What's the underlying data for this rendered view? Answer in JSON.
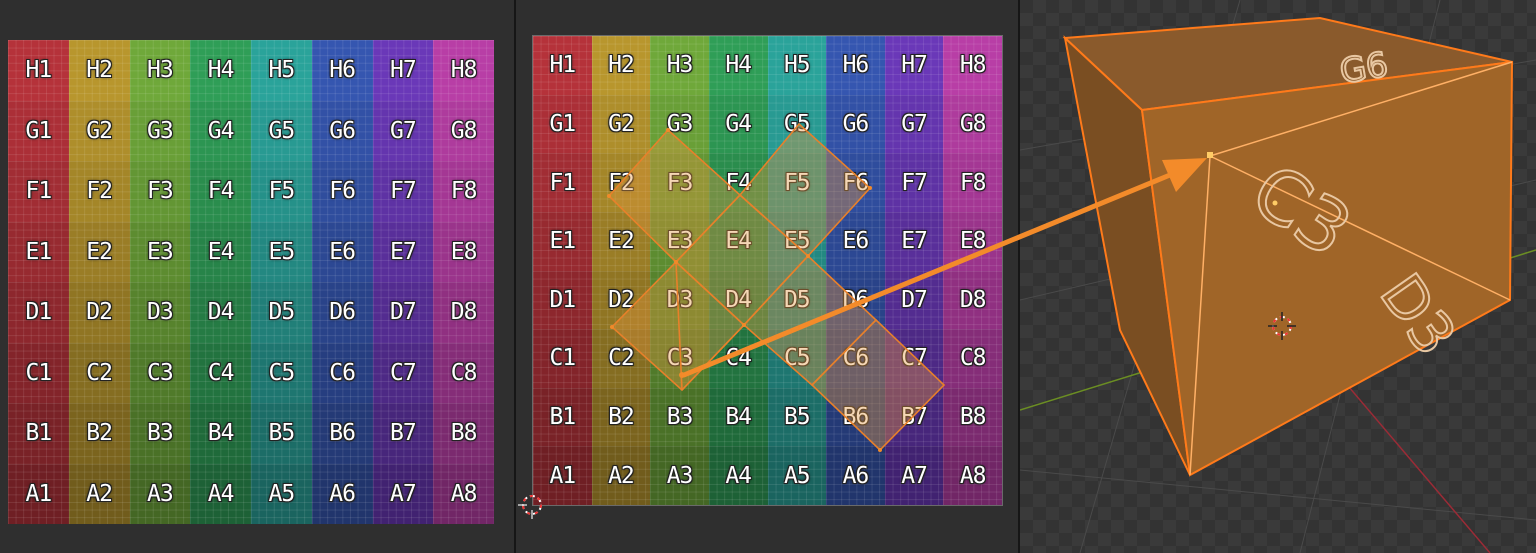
{
  "panels": {
    "left": {
      "name": "texture-view"
    },
    "middle": {
      "name": "uv-editor"
    },
    "right": {
      "name": "3d-viewport"
    }
  },
  "texture": {
    "rows": [
      "H",
      "G",
      "F",
      "E",
      "D",
      "C",
      "B",
      "A"
    ],
    "cols": [
      "1",
      "2",
      "3",
      "4",
      "5",
      "6",
      "7",
      "8"
    ],
    "column_colors": [
      "#b5323a",
      "#b8962d",
      "#6fa83a",
      "#2f9e57",
      "#2aa39a",
      "#3556b0",
      "#6a38b8",
      "#b83ea6"
    ]
  },
  "viewport_face_labels": {
    "front": "C3",
    "side": "D3",
    "top": "G6"
  },
  "accent_colors": {
    "selection_orange": "#f38b2a",
    "mesh_edge": "#ff7a1a",
    "x_axis_red": "#9b2b36",
    "y_axis_green": "#6b8e23"
  },
  "icons": [
    "3d-cursor-icon"
  ]
}
